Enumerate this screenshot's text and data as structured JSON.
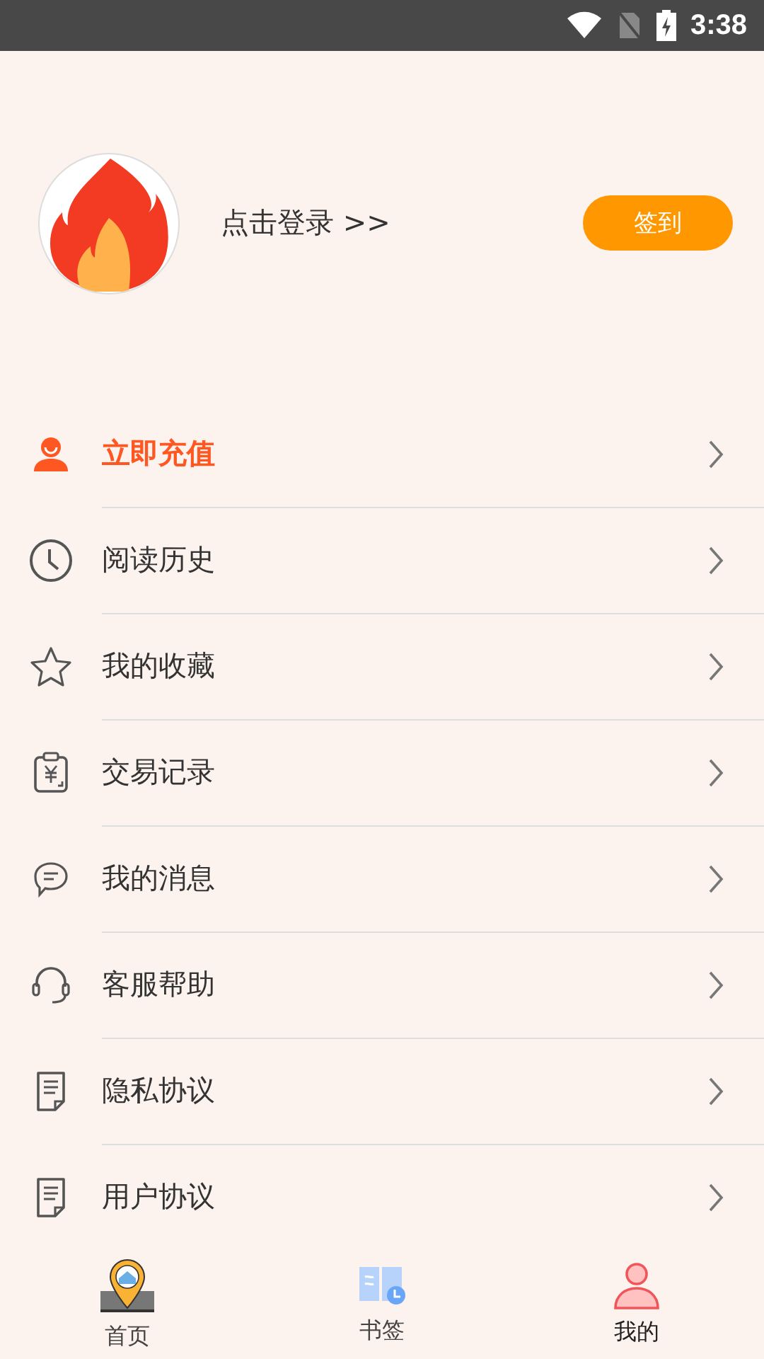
{
  "status_bar": {
    "time": "3:38"
  },
  "profile": {
    "login_text": "点击登录 >>",
    "checkin_button": "签到"
  },
  "menu": [
    {
      "kind": "recharge",
      "label": "立即充值",
      "highlighted": true
    },
    {
      "kind": "history",
      "label": "阅读历史",
      "highlighted": false
    },
    {
      "kind": "favorites",
      "label": "我的收藏",
      "highlighted": false
    },
    {
      "kind": "transactions",
      "label": "交易记录",
      "highlighted": false
    },
    {
      "kind": "messages",
      "label": "我的消息",
      "highlighted": false
    },
    {
      "kind": "support",
      "label": "客服帮助",
      "highlighted": false
    },
    {
      "kind": "document",
      "label": "隐私协议",
      "highlighted": false
    },
    {
      "kind": "document",
      "label": "用户协议",
      "highlighted": false
    }
  ],
  "tabs": [
    {
      "kind": "home",
      "label": "首页",
      "selected": false
    },
    {
      "kind": "bookmarks",
      "label": "书签",
      "selected": false
    },
    {
      "kind": "mine",
      "label": "我的",
      "selected": true
    }
  ]
}
